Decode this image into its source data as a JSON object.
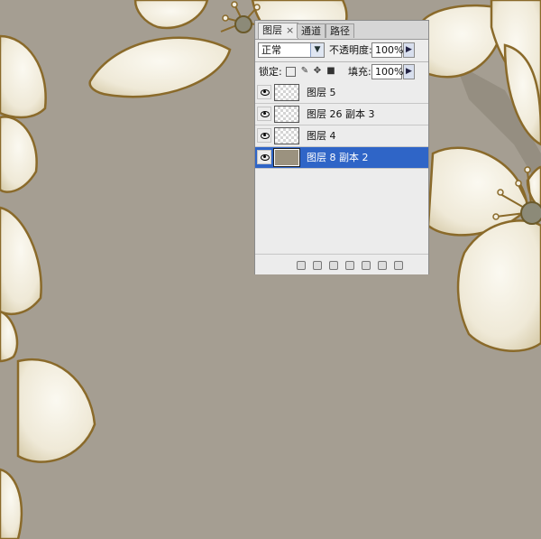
{
  "panel": {
    "tabs": [
      {
        "label": "图层",
        "close": "×"
      },
      {
        "label": "通道"
      },
      {
        "label": "路径"
      }
    ],
    "blend_mode": "正常",
    "opacity_label": "不透明度:",
    "opacity_value": "100%",
    "lock_label": "锁定:",
    "lock_icons": [
      "lock-transparent-icon",
      "lock-paint-icon",
      "lock-move-icon",
      "lock-all-icon"
    ],
    "fill_label": "填充:",
    "fill_value": "100%",
    "layers": [
      {
        "name": "图层 5",
        "selected": false
      },
      {
        "name": "图层 26 副本 3",
        "selected": false
      },
      {
        "name": "图层 4",
        "selected": false
      },
      {
        "name": "图层 8 副本 2",
        "selected": true
      }
    ]
  },
  "colors": {
    "canvas_bg": "#a59e92",
    "petal": "#f3efe2",
    "petal_outline": "#8a6a2a",
    "selected_layer": "#2f65c7"
  }
}
